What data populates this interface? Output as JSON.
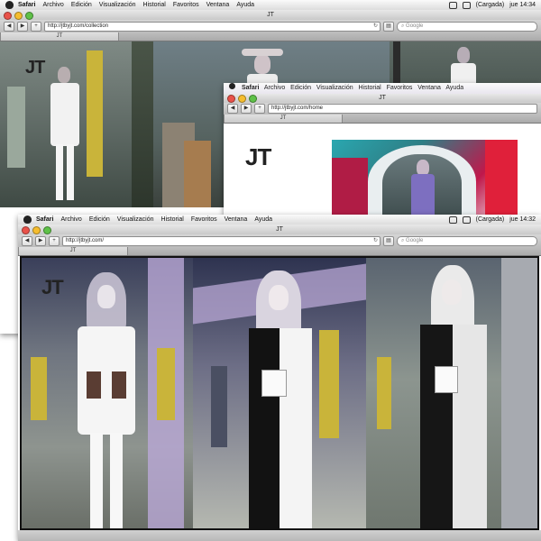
{
  "menubar": {
    "items": [
      "Safari",
      "Archivo",
      "Edición",
      "Visualización",
      "Historial",
      "Favoritos",
      "Ventana",
      "Ayuda"
    ],
    "battery": "(Cargada)",
    "clock_back": "jue 14:34",
    "clock_front": "jue 14:32"
  },
  "windows": {
    "back": {
      "title": "JT",
      "url": "http://jtbyjt.com/collection",
      "tab": "JT",
      "search_placeholder": "Google"
    },
    "middle": {
      "title": "JT",
      "url": "http://jtbyjt.com/home",
      "tab": "JT",
      "logo": "JT"
    },
    "front": {
      "title": "JT",
      "url": "http://jtbyjt.com/",
      "tab": "JT",
      "search_placeholder": "Google",
      "logo": "JT"
    }
  },
  "colors": {
    "menubar": "#e6e6e6",
    "chrome": "#c8c8c8",
    "lavender": "#b9a8d6",
    "pillar_yellow": "#c9b43a"
  },
  "icons": [
    "apple-icon",
    "back-icon",
    "forward-icon",
    "add-icon",
    "reload-icon",
    "search-icon",
    "rss-icon",
    "wifi-icon",
    "battery-icon"
  ]
}
